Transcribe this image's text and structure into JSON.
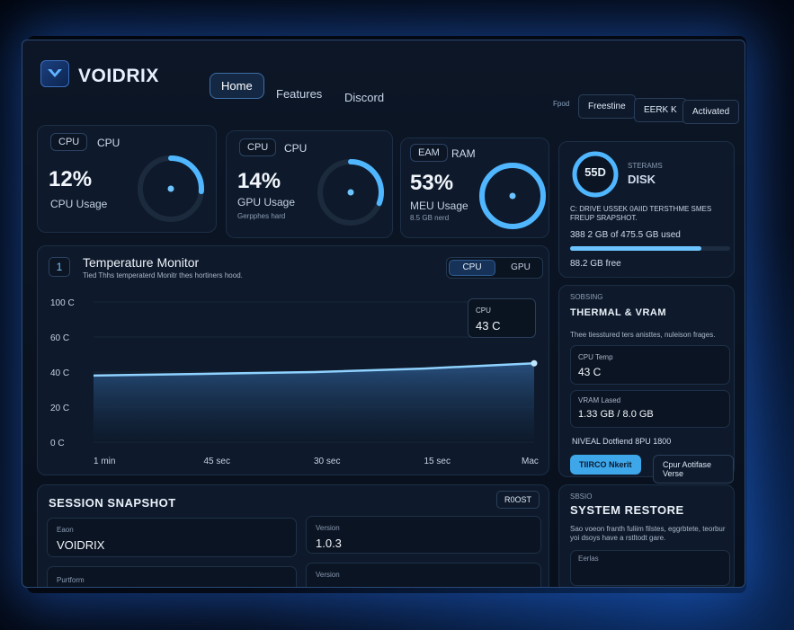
{
  "app": {
    "brand": "VOIDRIX"
  },
  "nav": {
    "home": "Home",
    "features": "Features",
    "discord": "Discord"
  },
  "header": {
    "small_label": "Fpod",
    "btn1": "Freestine",
    "btn2": "EERK K",
    "btn3": "Activated"
  },
  "cpu_card": {
    "pill": "CPU",
    "title": "CPU",
    "value": "12%",
    "label": "CPU Usage",
    "percent": 12
  },
  "gpu_card": {
    "pill": "CPU",
    "title": "CPU",
    "value": "14%",
    "label": "GPU Usage",
    "sub": "Gerpphes hard",
    "percent": 14
  },
  "ram_card": {
    "pill": "EAM",
    "title": "RAM",
    "value": "53%",
    "label": "MEU Usage",
    "sub": "8.5 GB nerd",
    "percent": 53
  },
  "disk_card": {
    "ring_label": "55D",
    "small": "STERAMS",
    "title": "DISK",
    "desc": "C: DRIVE USSEK 0AIID TERSTHME SMES FREUP SRAPSHOT.",
    "used": "388 2 GB of 475.5 GB used",
    "free": "88.2 GB free",
    "usage_fraction": 0.82
  },
  "temp_monitor": {
    "index": "1",
    "title": "Temperature Monitor",
    "desc": "Tied Thhs temperaterd Monitr thes hortiners hood.",
    "toggle_cpu": "CPU",
    "toggle_gpu": "GPU",
    "tooltip_label": "CPU",
    "tooltip_value": "43 C"
  },
  "chart_data": {
    "type": "area",
    "y_ticks": [
      "100 C",
      "60 C",
      "40 C",
      "20 C",
      "0 C"
    ],
    "x_ticks": [
      "1 min",
      "45 sec",
      "30 sec",
      "15 sec",
      "Mac"
    ],
    "x": [
      "1 min",
      "45 sec",
      "30 sec",
      "15 sec",
      "Mac"
    ],
    "values": [
      38,
      39,
      40,
      42,
      45
    ],
    "ylim": [
      0,
      100
    ],
    "grid": true
  },
  "thermal": {
    "small": "SOBSING",
    "title": "THERMAL & VRAM",
    "desc": "Thee tiesstured ters anisttes, nuleison frages.",
    "cpu_temp_label": "CPU Temp",
    "cpu_temp_value": "43 C",
    "vram_label": "VRAM Lased",
    "vram_value": "1.33 GB / 8.0 GB",
    "gpu_name": "NIVEAL Dotfiend 8PU 1800",
    "btn1": "TIIRCO Nkerit",
    "btn2": "Cpur Aotifase Verse"
  },
  "session": {
    "title": "SESSION SNAPSHOT",
    "badge": "R0OST",
    "f1_label": "Eaon",
    "f1_value": "VOIDRIX",
    "f2_label": "Version",
    "f2_value": "1.0.3",
    "f3_label": "Purtform",
    "f4_label": "Version"
  },
  "restore": {
    "small": "SBSIO",
    "title": "SYSTEM RESTORE",
    "desc": "Sao voeon franth fuliim filstes, eggrbtete, teorbur yoi dsoys have a rstltodt gare.",
    "footer": "Eerlas"
  }
}
